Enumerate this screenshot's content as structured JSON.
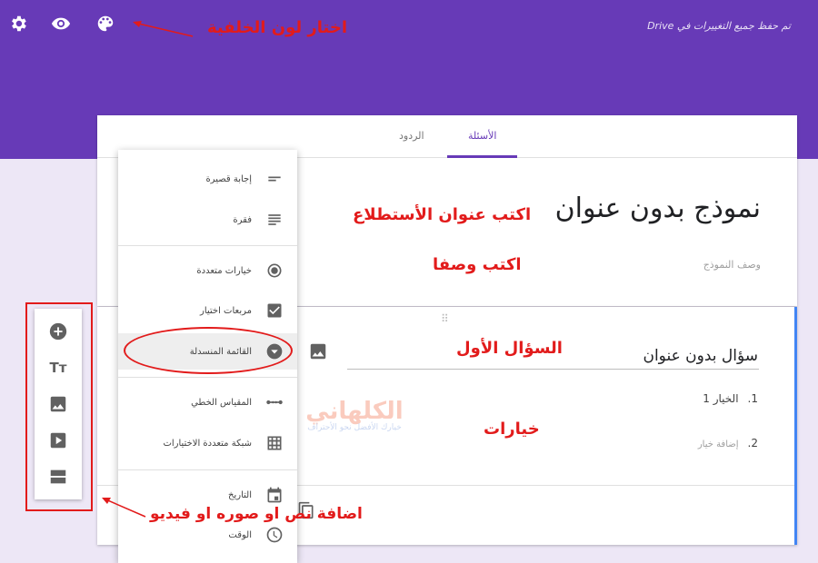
{
  "header": {
    "save_status": "تم حفظ جميع التغييرات في Drive",
    "icons": [
      "gear-icon",
      "eye-icon",
      "palette-icon"
    ]
  },
  "annotations": {
    "background_color": "اختار لون الخلفية",
    "write_title": "اكتب عنوان الأستطلاع",
    "write_description": "اكتب وصفا",
    "first_question": "السؤال الأول",
    "choices": "خيارات",
    "add_media": "اضافة نص او صوره او فيديو"
  },
  "tabs": {
    "questions": "الأسئلة",
    "responses": "الردود",
    "active": "questions"
  },
  "form": {
    "title": "نموذج بدون عنوان",
    "description_placeholder": "وصف النموذج"
  },
  "question": {
    "title": "سؤال بدون عنوان",
    "options": [
      {
        "num": "1.",
        "label": "الخيار 1"
      },
      {
        "num": "2.",
        "label": "إضافة خيار"
      }
    ]
  },
  "question_types": [
    {
      "label": "إجابة قصيرة",
      "icon": "short-answer-icon"
    },
    {
      "label": "فقرة",
      "icon": "paragraph-icon"
    },
    {
      "label": "خيارات متعددة",
      "icon": "radio-icon"
    },
    {
      "label": "مربعات اختيار",
      "icon": "checkbox-icon"
    },
    {
      "label": "القائمة المنسدلة",
      "icon": "dropdown-icon",
      "selected": true
    },
    {
      "label": "المقياس الخطي",
      "icon": "linear-scale-icon"
    },
    {
      "label": "شبكة متعددة الاختيارات",
      "icon": "grid-icon"
    },
    {
      "label": "التاريخ",
      "icon": "calendar-icon"
    },
    {
      "label": "الوقت",
      "icon": "clock-icon"
    }
  ],
  "side_toolbar": [
    "add-question-icon",
    "add-title-text-icon",
    "add-image-icon",
    "add-video-icon",
    "add-section-icon"
  ],
  "watermark": {
    "main": "الكلهاني",
    "sub": "خيارك الأفضل نحو الأحتراف"
  },
  "colors": {
    "theme": "#673ab7",
    "background": "#ede7f6",
    "annotation": "#e21b1b",
    "accent_blue": "#4285f4"
  }
}
